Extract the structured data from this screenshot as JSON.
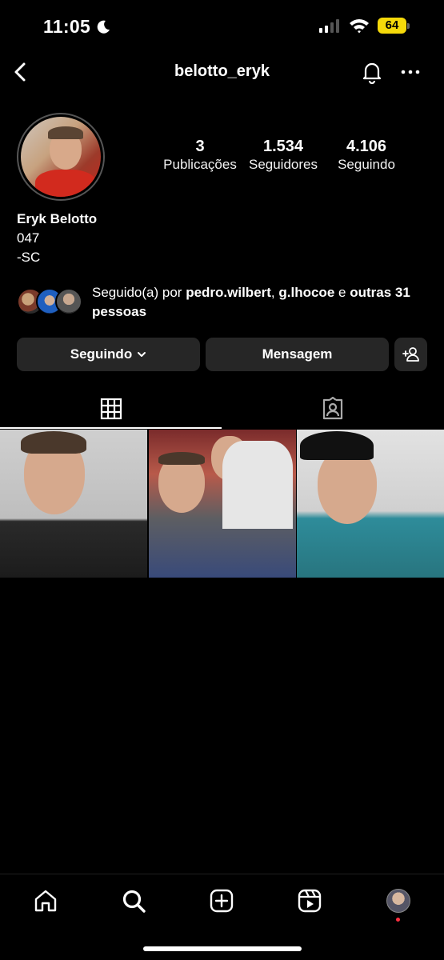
{
  "status": {
    "time": "11:05",
    "battery": "64"
  },
  "header": {
    "username": "belotto_eryk"
  },
  "profile": {
    "stats": [
      {
        "value": "3",
        "label": "Publicações"
      },
      {
        "value": "1.534",
        "label": "Seguidores"
      },
      {
        "value": "4.106",
        "label": "Seguindo"
      }
    ],
    "name": "Eryk Belotto",
    "bio_lines": [
      "047",
      "-SC"
    ]
  },
  "followed_by": {
    "prefix": "Seguido(a) por ",
    "user1": "pedro.wilbert",
    "sep": ", ",
    "user2": "g.lhocoe",
    "and": " e ",
    "others": "outras 31 pessoas"
  },
  "actions": {
    "following_label": "Seguindo",
    "message_label": "Mensagem"
  },
  "icons": {
    "back": "chevron-left-icon",
    "bell": "bell-icon",
    "more": "more-horizontal-icon",
    "grid": "grid-icon",
    "tagged": "tagged-person-icon",
    "home": "home-icon",
    "search": "search-icon",
    "create": "plus-square-icon",
    "reels": "reels-icon"
  },
  "colors": {
    "background": "#000000",
    "button_bg": "#262626",
    "battery": "#f5d90a",
    "notification_dot": "#ff3040"
  }
}
